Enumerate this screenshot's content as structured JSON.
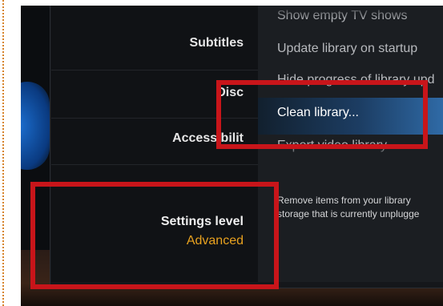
{
  "categories": {
    "subtitles": "Subtitles",
    "disc": "Disc",
    "accessibility": "Accessibilit"
  },
  "settings_level": {
    "label": "Settings level",
    "value": "Advanced"
  },
  "options": {
    "show_empty_tv_shows": "Show empty TV shows",
    "update_library_on_startup": "Update library on startup",
    "hide_progress": "Hide progress of library upd",
    "clean_library": "Clean library...",
    "export_video_library": "Export video library"
  },
  "description": {
    "line1": "Remove items from your library",
    "line2": "storage that is currently unplugge"
  },
  "colors": {
    "highlight_box": "#c8151a",
    "settings_level_value": "#e8a21f",
    "focus_bar": "#2f6aa6"
  }
}
